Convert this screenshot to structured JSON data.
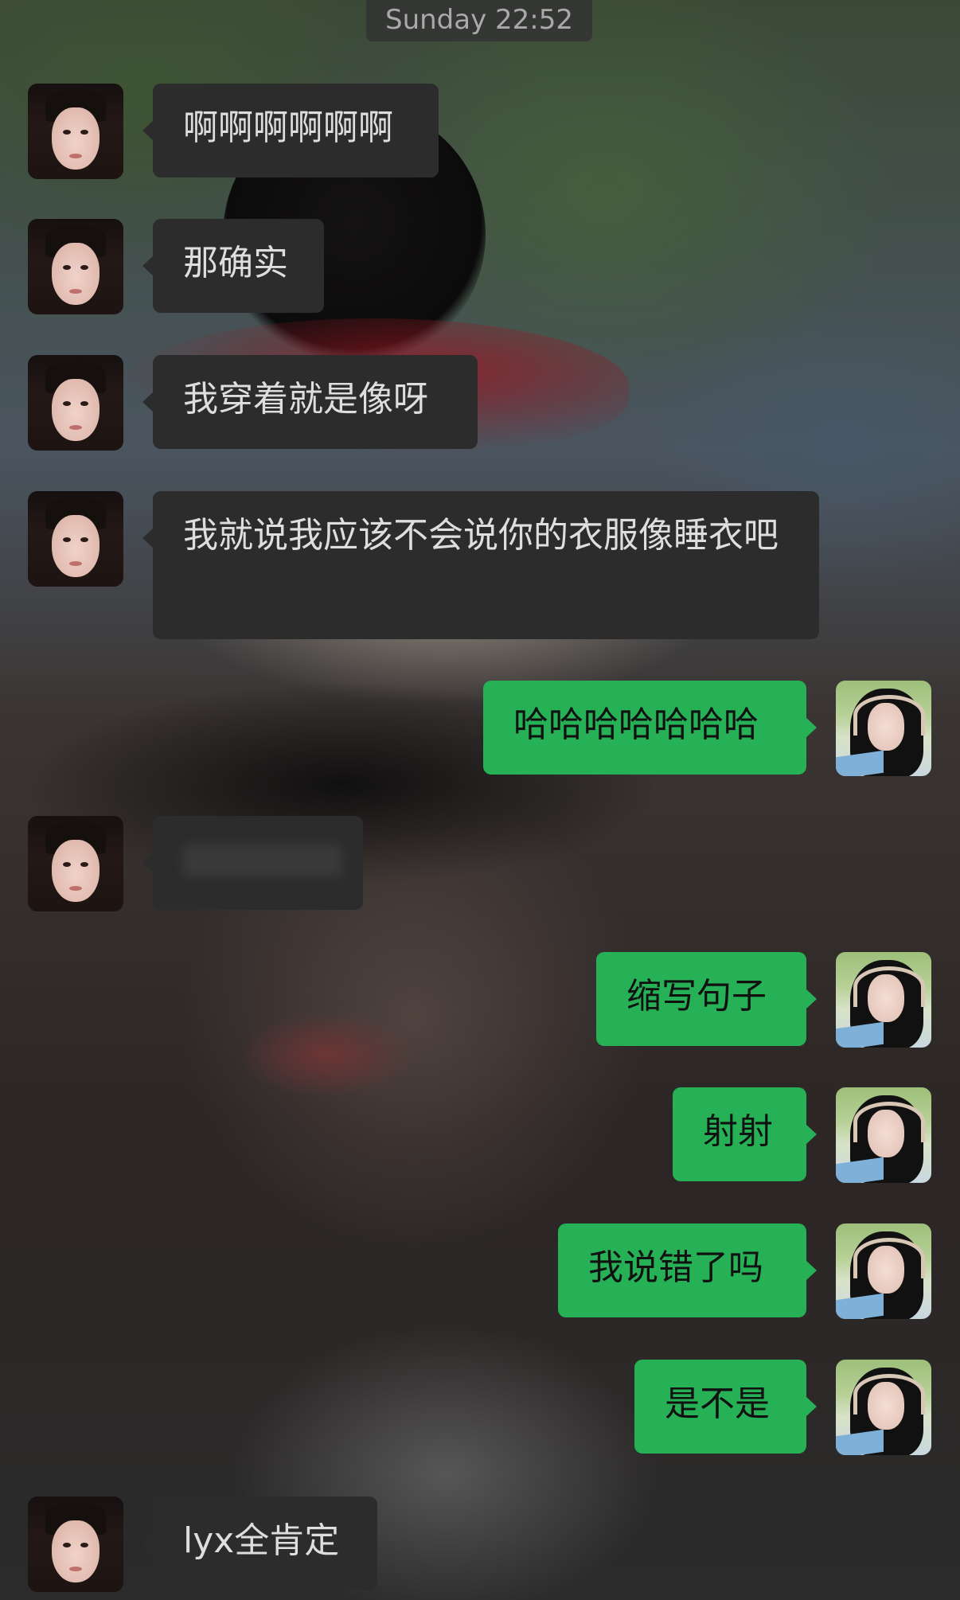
{
  "chat": {
    "timestamp": "Sunday 22:52",
    "messages": [
      {
        "side": "in",
        "text": "啊啊啊啊啊啊"
      },
      {
        "side": "in",
        "text": "那确实"
      },
      {
        "side": "in",
        "text": "我穿着就是像呀"
      },
      {
        "side": "in",
        "text": "我就说我应该不会说你的衣服像睡衣吧"
      },
      {
        "side": "out",
        "text": "哈哈哈哈哈哈哈"
      },
      {
        "side": "in",
        "text": ""
      },
      {
        "side": "out",
        "text": "缩写句子"
      },
      {
        "side": "out",
        "text": "射射"
      },
      {
        "side": "out",
        "text": "我说错了吗"
      },
      {
        "side": "out",
        "text": "是不是"
      },
      {
        "side": "in",
        "text": "lyx全肯定"
      }
    ]
  }
}
